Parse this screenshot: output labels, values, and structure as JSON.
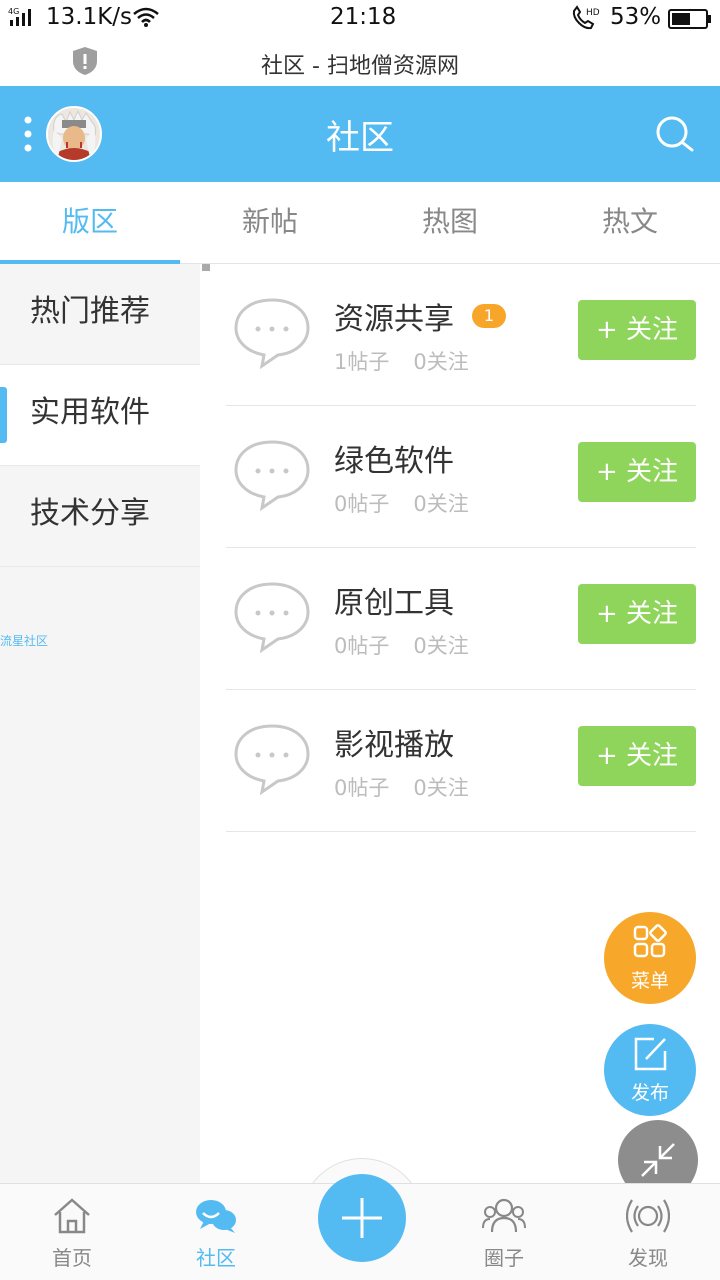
{
  "status_bar": {
    "network": "4G",
    "speed": "13.1K/s",
    "time": "21:18",
    "call_label": "HD",
    "battery": "53%"
  },
  "browser": {
    "page_title": "社区 - 扫地僧资源网"
  },
  "header": {
    "title": "社区"
  },
  "tabs": [
    {
      "label": "版区",
      "active": true
    },
    {
      "label": "新帖",
      "active": false
    },
    {
      "label": "热图",
      "active": false
    },
    {
      "label": "热文",
      "active": false
    }
  ],
  "sidebar": {
    "items": [
      {
        "label": "热门推荐",
        "active": false
      },
      {
        "label": "实用软件",
        "active": true
      },
      {
        "label": "技术分享",
        "active": false
      }
    ],
    "footer": "流星社区"
  },
  "forums": [
    {
      "name": "资源共享",
      "badge": "1",
      "posts": "1帖子",
      "follows": "0关注",
      "button": "+ 关注"
    },
    {
      "name": "绿色软件",
      "badge": "",
      "posts": "0帖子",
      "follows": "0关注",
      "button": "+ 关注"
    },
    {
      "name": "原创工具",
      "badge": "",
      "posts": "0帖子",
      "follows": "0关注",
      "button": "+ 关注"
    },
    {
      "name": "影视播放",
      "badge": "",
      "posts": "0帖子",
      "follows": "0关注",
      "button": "+ 关注"
    }
  ],
  "fabs": {
    "menu": "菜单",
    "post": "发布"
  },
  "bottom_nav": [
    {
      "label": "首页",
      "icon": "home-icon",
      "active": false
    },
    {
      "label": "社区",
      "icon": "chat-bubbles-icon",
      "active": true
    },
    {
      "label": "",
      "icon": "plus-icon",
      "active": false
    },
    {
      "label": "圈子",
      "icon": "people-icon",
      "active": false
    },
    {
      "label": "发现",
      "icon": "broadcast-icon",
      "active": false
    }
  ],
  "colors": {
    "accent": "#54bbf2",
    "follow_button": "#8fd55b",
    "badge": "#f7a629",
    "menu_fab": "#f7a72a",
    "collapse_fab": "#8d8d8d"
  }
}
